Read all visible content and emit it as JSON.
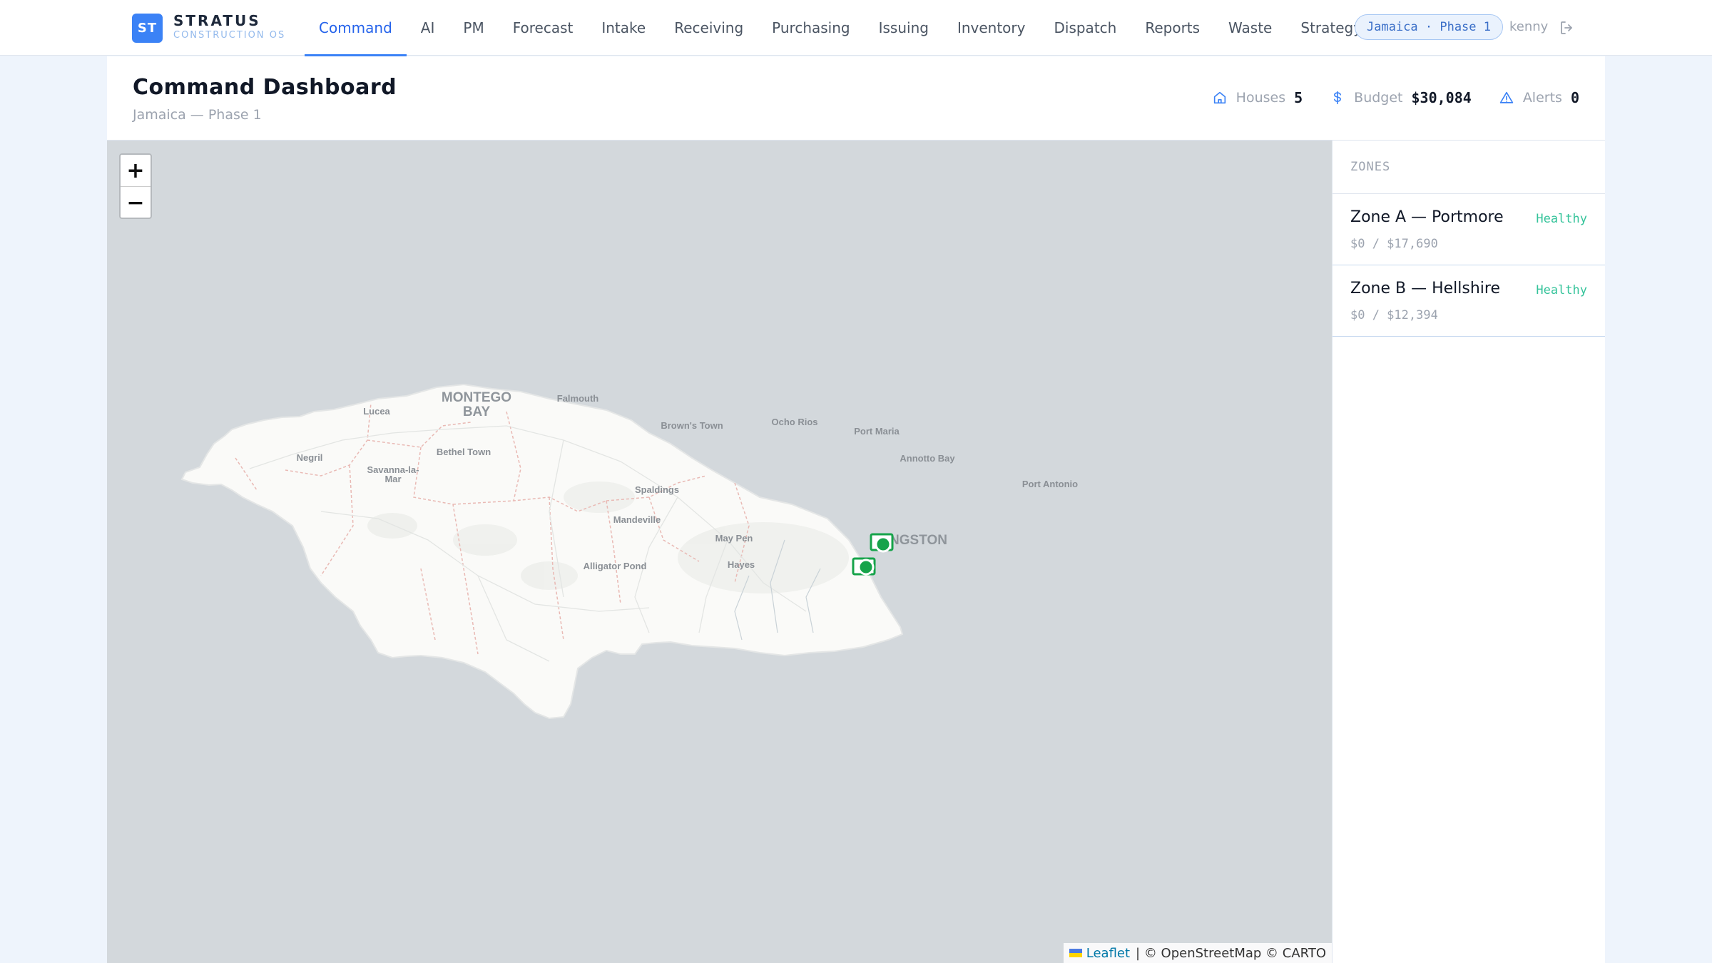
{
  "brand": {
    "mark": "ST",
    "title": "STRATUS",
    "subtitle": "CONSTRUCTION OS"
  },
  "nav": {
    "items": [
      {
        "label": "Command",
        "active": true
      },
      {
        "label": "AI"
      },
      {
        "label": "PM"
      },
      {
        "label": "Forecast"
      },
      {
        "label": "Intake"
      },
      {
        "label": "Receiving"
      },
      {
        "label": "Purchasing"
      },
      {
        "label": "Issuing"
      },
      {
        "label": "Inventory"
      },
      {
        "label": "Dispatch"
      },
      {
        "label": "Reports"
      },
      {
        "label": "Waste"
      },
      {
        "label": "Strategy"
      }
    ],
    "phase_pill": "Jamaica · Phase 1",
    "user": "kenny",
    "logout_icon": "logout-icon"
  },
  "header": {
    "title": "Command Dashboard",
    "subtitle": "Jamaica — Phase 1",
    "stats": [
      {
        "icon": "house-icon",
        "label": "Houses",
        "value": "5"
      },
      {
        "icon": "dollar-icon",
        "label": "Budget",
        "value": "$30,084"
      },
      {
        "icon": "alert-triangle-icon",
        "label": "Alerts",
        "value": "0"
      }
    ]
  },
  "map": {
    "zoom_in": "+",
    "zoom_out": "−",
    "places": [
      "MONTEGO",
      "BAY",
      "Falmouth",
      "Lucea",
      "Brown's Town",
      "Ocho Rios",
      "Port Maria",
      "Negril",
      "Bethel Town",
      "Annotto Bay",
      "Savanna-la-",
      "Mar",
      "Port Antonio",
      "Spaldings",
      "Mandeville",
      "May Pen",
      "KINGSTON",
      "Alligator Pond",
      "Hayes"
    ],
    "attribution_leaflet": "Leaflet",
    "attribution_rest": "| © OpenStreetMap © CARTO",
    "colors": {
      "water": "#d3d8dc",
      "land": "#fafaf8",
      "marker": "#16a34a"
    }
  },
  "zones": {
    "header": "ZONES",
    "items": [
      {
        "name": "Zone A — Portmore",
        "status": "Healthy",
        "budget": "$0 / $17,690"
      },
      {
        "name": "Zone B — Hellshire",
        "status": "Healthy",
        "budget": "$0 / $12,394"
      }
    ]
  }
}
